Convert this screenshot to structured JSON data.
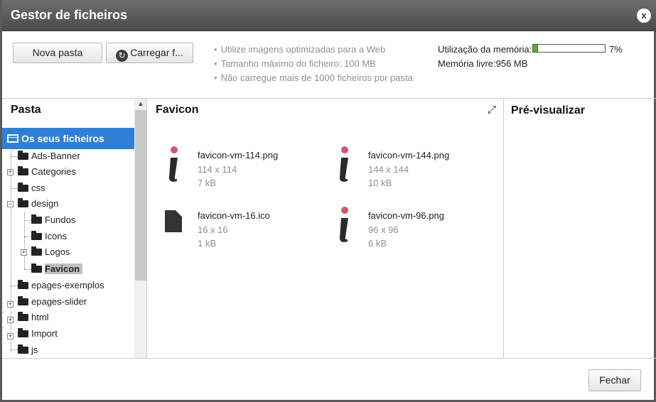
{
  "window": {
    "title": "Gestor de ficheiros",
    "close_label": "x"
  },
  "toolbar": {
    "new_folder_label": "Nova pasta",
    "upload_label": "Carregar f..."
  },
  "tips": [
    "Utilize imagens optimizadas para a Web",
    "Tamanho máximo do ficheiro: 100 MB",
    "Não carregue mais de 1000 ficheiros por pasta"
  ],
  "memory": {
    "usage_label": "Utilização da memória:",
    "usage_percent": "7%",
    "usage_fraction": 0.07,
    "free_label": "Memória livre:956 MB"
  },
  "folder_panel": {
    "header": "Pasta",
    "root": "Os seus ficheiros",
    "items": [
      {
        "label": "Ads-Banner"
      },
      {
        "label": "Categories"
      },
      {
        "label": "css"
      },
      {
        "label": "design"
      },
      {
        "label": "Fundos"
      },
      {
        "label": "Icons"
      },
      {
        "label": "Logos"
      },
      {
        "label": "Favicon"
      },
      {
        "label": "epages-exemplos"
      },
      {
        "label": "epages-slider"
      },
      {
        "label": "html"
      },
      {
        "label": "Import"
      },
      {
        "label": "js"
      }
    ]
  },
  "file_panel": {
    "header": "Favicon",
    "files": [
      {
        "name": "favicon-vm-114.png",
        "dimensions": "114 x 114",
        "size": "7 kB",
        "icon": "info-icon"
      },
      {
        "name": "favicon-vm-144.png",
        "dimensions": "144 x 144",
        "size": "10 kB",
        "icon": "info-icon"
      },
      {
        "name": "favicon-vm-16.ico",
        "dimensions": "16 x 16",
        "size": "1 kB",
        "icon": "document-icon"
      },
      {
        "name": "favicon-vm-96.png",
        "dimensions": "96 x 96",
        "size": "6 kB",
        "icon": "info-icon"
      }
    ]
  },
  "preview_panel": {
    "header": "Pré-visualizar"
  },
  "footer": {
    "close_button_label": "Fechar"
  },
  "colors": {
    "accent": "#2f7fd6",
    "titlebar": "#5a5a5a",
    "memory_fill": "#5cae2a",
    "info_dot": "#d9536a"
  }
}
